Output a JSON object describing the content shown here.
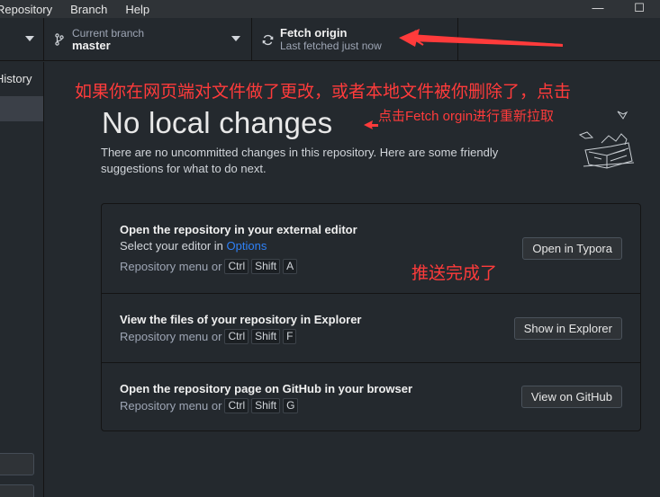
{
  "menu": {
    "items": [
      "Repository",
      "Branch",
      "Help"
    ]
  },
  "window_controls": {
    "minimize": "—",
    "maximize": "☐"
  },
  "toolbar": {
    "branch": {
      "label": "Current branch",
      "value": "master",
      "icon": "git-branch-icon"
    },
    "fetch": {
      "label": "Fetch origin",
      "value": "Last fetched just now",
      "icon": "sync-icon"
    }
  },
  "sidebar": {
    "tab_label": "History"
  },
  "main": {
    "title": "No local changes",
    "description": "There are no uncommitted changes in this repository. Here are some friendly suggestions for what to do next.",
    "suggestions": [
      {
        "title": "Open the repository in your external editor",
        "sub_prefix": "Select your editor in ",
        "sub_link": "Options",
        "shortcut_prefix": "Repository menu or",
        "keys": [
          "Ctrl",
          "Shift",
          "A"
        ],
        "button": "Open in Typora"
      },
      {
        "title": "View the files of your repository in Explorer",
        "shortcut_prefix": "Repository menu or",
        "keys": [
          "Ctrl",
          "Shift",
          "F"
        ],
        "button": "Show in Explorer"
      },
      {
        "title": "Open the repository page on GitHub in your browser",
        "shortcut_prefix": "Repository menu or",
        "keys": [
          "Ctrl",
          "Shift",
          "G"
        ],
        "button": "View on GitHub"
      }
    ]
  },
  "annotations": {
    "note1": "如果你在网页端对文件做了更改，或者本地文件被你删除了，点击",
    "note2": "点击Fetch orgin进行重新拉取",
    "note3": "推送完成了",
    "color": "#ff3b3b"
  }
}
